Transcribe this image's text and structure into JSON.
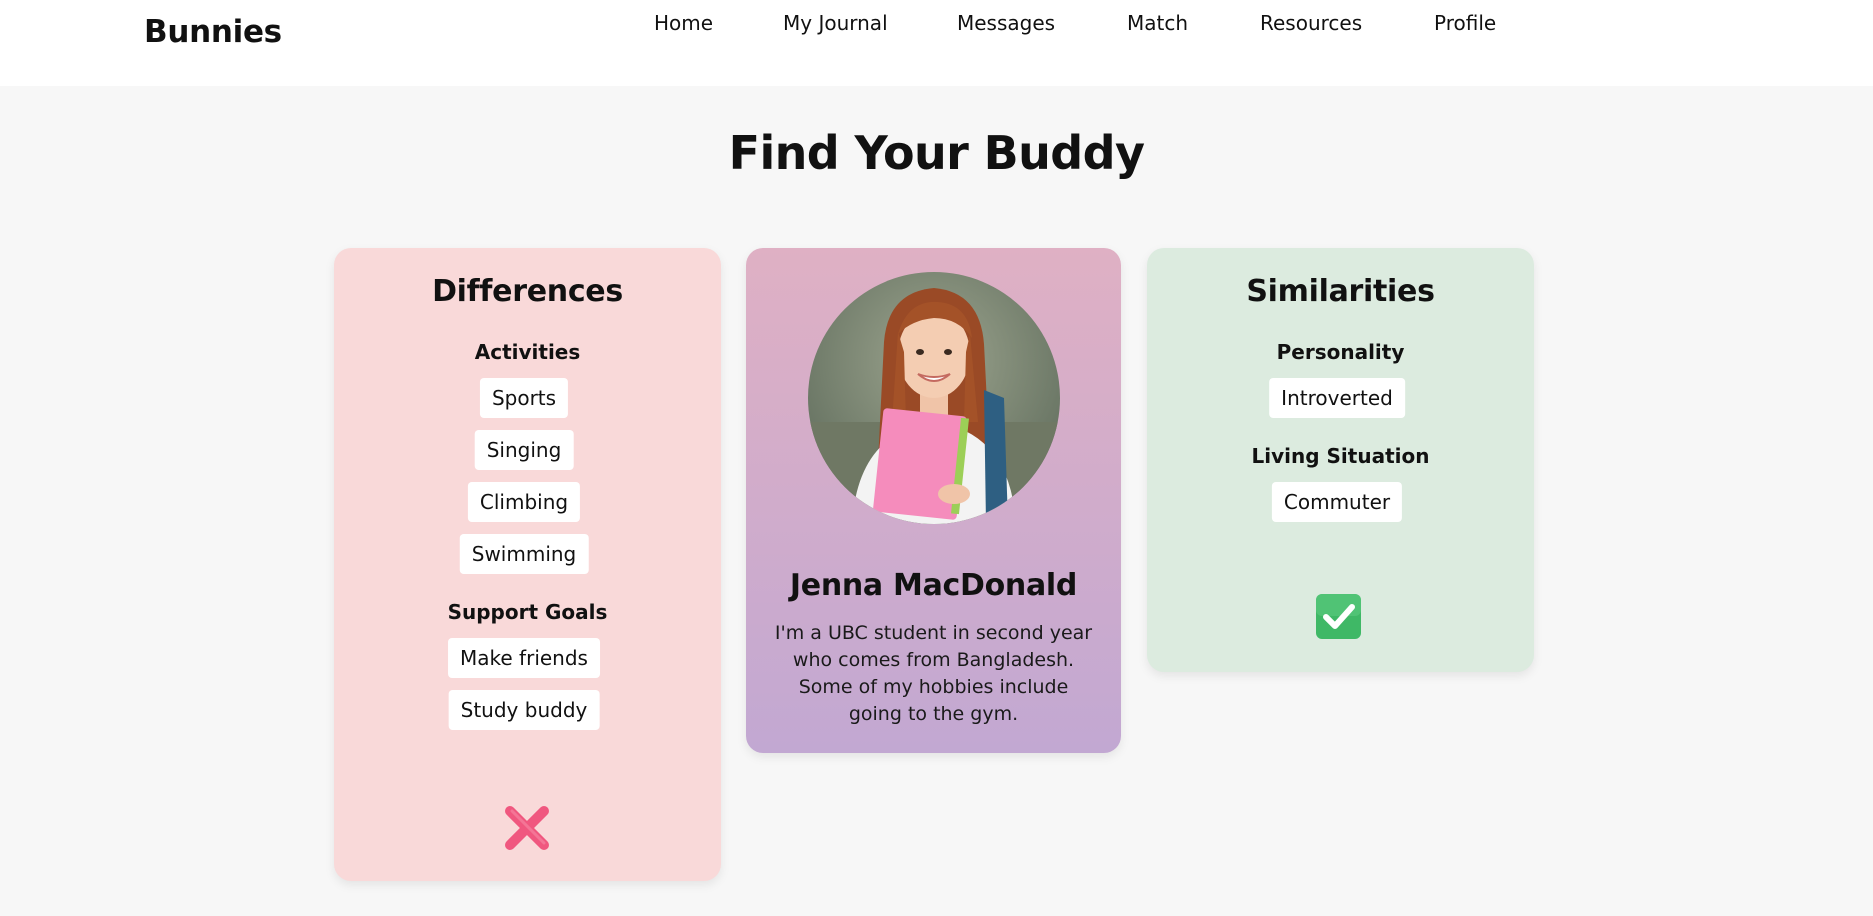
{
  "header": {
    "brand": "Bunnies",
    "nav": {
      "home": "Home",
      "journal": "My Journal",
      "messages": "Messages",
      "match": "Match",
      "resources": "Resources",
      "profile": "Profile"
    }
  },
  "page": {
    "title": "Find Your Buddy"
  },
  "differences": {
    "title": "Differences",
    "activities_label": "Activities",
    "activities": [
      "Sports",
      "Singing",
      "Climbing",
      "Swimming"
    ],
    "goals_label": "Support Goals",
    "goals": [
      "Make friends",
      "Study buddy"
    ],
    "action_icon": "cross-mark-icon"
  },
  "profile": {
    "name": "Jenna MacDonald",
    "bio": "I'm a UBC student in second year who comes from Bangladesh. Some of my hobbies include going to the gym."
  },
  "similarities": {
    "title": "Similarities",
    "personality_label": "Personality",
    "personality": [
      "Introverted"
    ],
    "living_label": "Living Situation",
    "living": [
      "Commuter"
    ],
    "action_icon": "check-mark-icon"
  },
  "colors": {
    "background": "#f7f7f7",
    "differences_card": "#f9d9d9",
    "profile_card_top": "#dfb0c4",
    "profile_card_bottom": "#c2a8d2",
    "similarities_card": "#dcebdf",
    "reject": "#f0577f",
    "accept": "#3fb866"
  }
}
